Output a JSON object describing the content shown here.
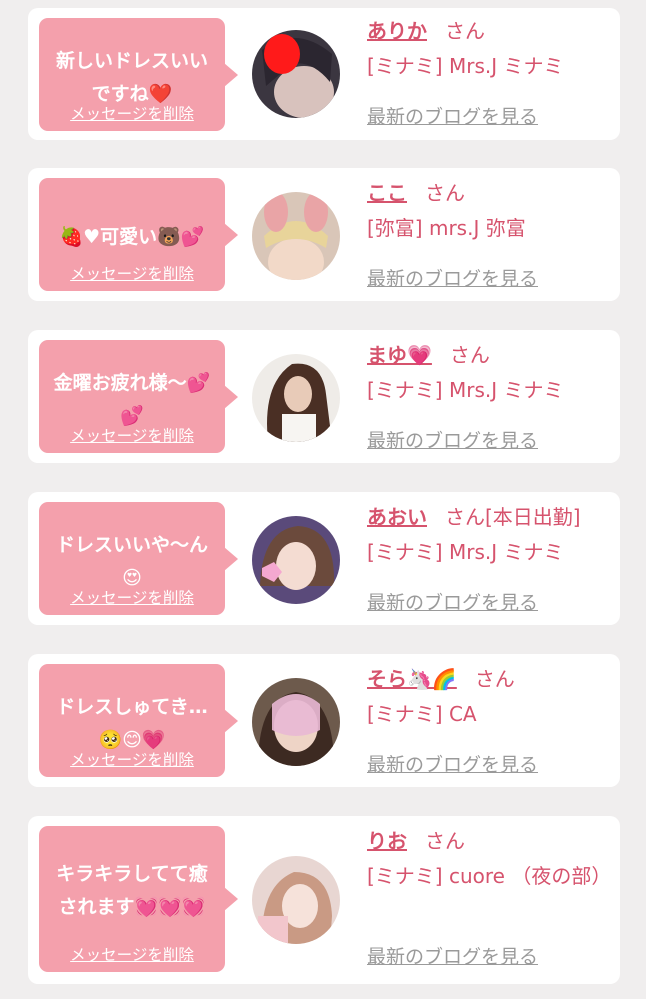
{
  "cards": [
    {
      "message": "新しいドレスいい\nですね❤️",
      "delete_label": "メッセージを削除",
      "name": "ありか",
      "suffix": "さん",
      "shop": "[ミナミ] Mrs.J ミナミ",
      "blog_label": "最新のブログを見る"
    },
    {
      "message": "🍓♥可愛い🐻💕",
      "delete_label": "メッセージを削除",
      "name": "ここ",
      "suffix": "さん",
      "shop": "[弥富] mrs.J 弥富",
      "blog_label": "最新のブログを見る"
    },
    {
      "message": "金曜お疲れ様〜💕\n💕",
      "delete_label": "メッセージを削除",
      "name": "まゆ💗",
      "suffix": "さん",
      "shop": "[ミナミ] Mrs.J ミナミ",
      "blog_label": "最新のブログを見る"
    },
    {
      "message": "ドレスいいや〜ん\n😍",
      "delete_label": "メッセージを削除",
      "name": "あおい",
      "suffix": "さん[本日出勤]",
      "shop": "[ミナミ] Mrs.J ミナミ",
      "blog_label": "最新のブログを見る"
    },
    {
      "message": "ドレスしゅてき…\n🥺😊💗",
      "delete_label": "メッセージを削除",
      "name": "そら🦄🌈",
      "suffix": "さん",
      "shop": "[ミナミ] CA",
      "blog_label": "最新のブログを見る"
    },
    {
      "message": "キラキラしてて癒\nされます💓💓💓",
      "delete_label": "メッセージを削除",
      "name": "りお",
      "suffix": "さん",
      "shop": "[ミナミ] cuore （夜の部）",
      "blog_label": "最新のブログを見る"
    }
  ],
  "colors": {
    "bubble": "#f4a0ac",
    "accent": "#d6536d",
    "link_gray": "#9a9a9a",
    "background": "#f0eeee"
  }
}
